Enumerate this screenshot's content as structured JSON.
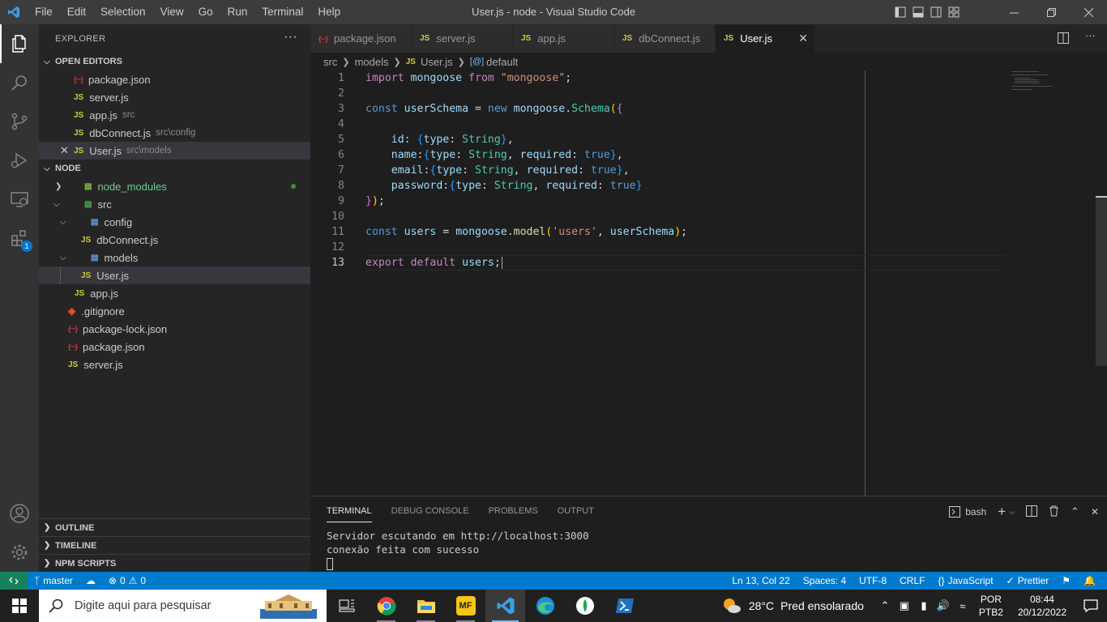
{
  "titlebar": {
    "menu": [
      "File",
      "Edit",
      "Selection",
      "View",
      "Go",
      "Run",
      "Terminal",
      "Help"
    ],
    "window_title": "User.js - node - Visual Studio Code"
  },
  "activity": {
    "extensions_badge": "1"
  },
  "explorer": {
    "title": "EXPLORER",
    "open_editors_label": "OPEN EDITORS",
    "open_editors": [
      {
        "icon": "json",
        "name": "package.json",
        "desc": ""
      },
      {
        "icon": "js",
        "name": "server.js",
        "desc": ""
      },
      {
        "icon": "js",
        "name": "app.js",
        "desc": "src"
      },
      {
        "icon": "js",
        "name": "dbConnect.js",
        "desc": "src\\config"
      },
      {
        "icon": "js",
        "name": "User.js",
        "desc": "src\\models"
      }
    ],
    "folder_label": "NODE",
    "tree": {
      "node_modules": "node_modules",
      "src": "src",
      "config": "config",
      "dbconnect": "dbConnect.js",
      "models": "models",
      "user": "User.js",
      "app": "app.js",
      "gitignore": ".gitignore",
      "package_lock": "package-lock.json",
      "package": "package.json",
      "server": "server.js"
    },
    "outline_label": "OUTLINE",
    "timeline_label": "TIMELINE",
    "npm_label": "NPM SCRIPTS"
  },
  "tabs": [
    {
      "icon": "json",
      "label": "package.json"
    },
    {
      "icon": "js",
      "label": "server.js"
    },
    {
      "icon": "js",
      "label": "app.js"
    },
    {
      "icon": "js",
      "label": "dbConnect.js"
    },
    {
      "icon": "js",
      "label": "User.js"
    }
  ],
  "breadcrumb": [
    "src",
    "models",
    "User.js",
    "default"
  ],
  "editor": {
    "line_numbers": [
      "1",
      "2",
      "3",
      "4",
      "5",
      "6",
      "7",
      "8",
      "9",
      "10",
      "11",
      "12",
      "13"
    ]
  },
  "panel": {
    "tabs": [
      "TERMINAL",
      "DEBUG CONSOLE",
      "PROBLEMS",
      "OUTPUT"
    ],
    "shell": "bash",
    "terminal_lines": [
      "Servidor escutando em http://localhost:3000",
      "conexão feita com sucesso"
    ]
  },
  "statusbar": {
    "branch": "master",
    "errors": "0",
    "warnings": "0",
    "position": "Ln 13, Col 22",
    "spaces": "Spaces: 4",
    "encoding": "UTF-8",
    "eol": "CRLF",
    "language": "JavaScript",
    "formatter": "Prettier"
  },
  "taskbar": {
    "search_placeholder": "Digite aqui para pesquisar",
    "temperature": "28°C",
    "weather": "Pred ensolarado",
    "lang1": "POR",
    "lang2": "PTB2",
    "time": "08:44",
    "date": "20/12/2022"
  },
  "colors": {
    "accent": "#007acc",
    "remote": "#16825d",
    "js_icon": "#cbcb41"
  }
}
